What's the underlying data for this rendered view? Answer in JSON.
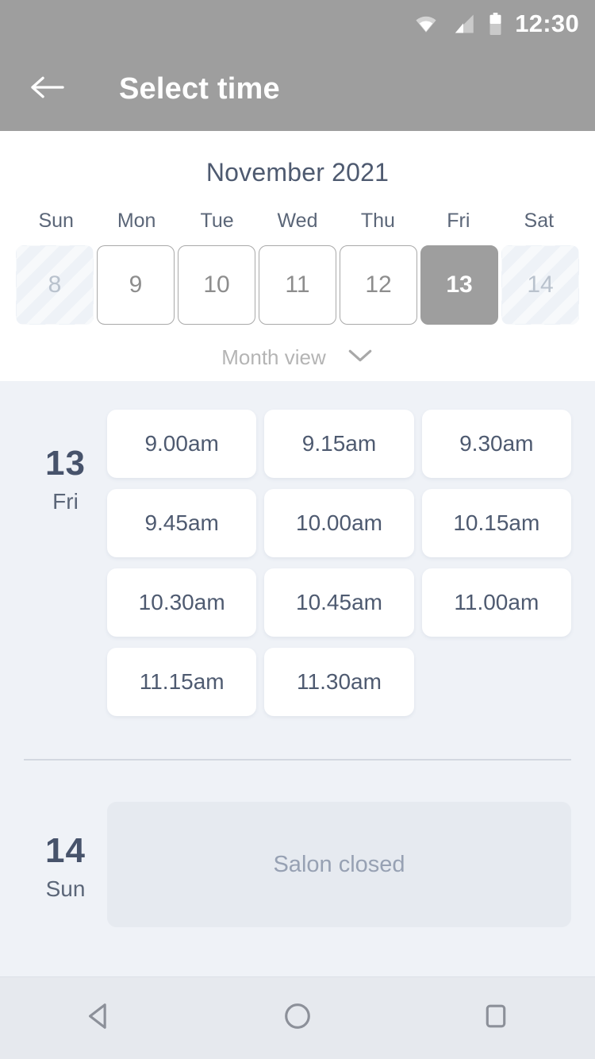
{
  "status_bar": {
    "time": "12:30",
    "icons": [
      "wifi-icon",
      "cell-signal-icon",
      "battery-icon"
    ]
  },
  "app_bar": {
    "back_icon": "arrow-left-icon",
    "title": "Select time"
  },
  "calendar": {
    "month_title": "November 2021",
    "weekdays": [
      "Sun",
      "Mon",
      "Tue",
      "Wed",
      "Thu",
      "Fri",
      "Sat"
    ],
    "days": [
      {
        "num": "8",
        "state": "disabled"
      },
      {
        "num": "9",
        "state": "enabled"
      },
      {
        "num": "10",
        "state": "enabled"
      },
      {
        "num": "11",
        "state": "enabled"
      },
      {
        "num": "12",
        "state": "enabled"
      },
      {
        "num": "13",
        "state": "selected"
      },
      {
        "num": "14",
        "state": "disabled"
      }
    ],
    "view_toggle": {
      "label": "Month view",
      "icon": "chevron-down-icon"
    }
  },
  "schedule": {
    "groups": [
      {
        "day_num": "13",
        "day_of_week": "Fri",
        "slots": [
          "9.00am",
          "9.15am",
          "9.30am",
          "9.45am",
          "10.00am",
          "10.15am",
          "10.30am",
          "10.45am",
          "11.00am",
          "11.15am",
          "11.30am"
        ],
        "closed_message": null
      },
      {
        "day_num": "14",
        "day_of_week": "Sun",
        "slots": [],
        "closed_message": "Salon closed"
      }
    ]
  },
  "nav_bar": {
    "buttons": [
      "back-triangle-icon",
      "home-circle-icon",
      "recents-square-icon"
    ]
  },
  "colors": {
    "app_bar": "#9e9e9e",
    "accent_dark": "#47536b",
    "slot_bg": "#eff2f7",
    "closed_bg": "#e6eaf0",
    "selected_day": "#9e9e9e"
  }
}
